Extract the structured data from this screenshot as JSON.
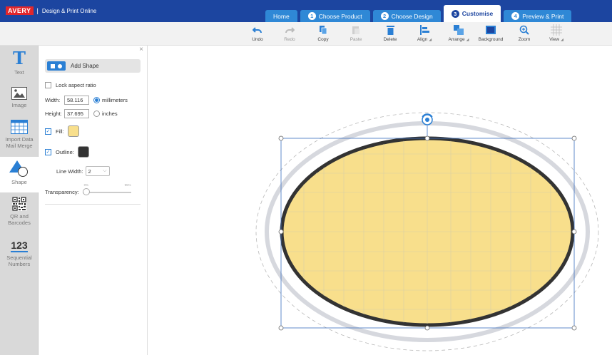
{
  "brand": {
    "logo": "AVERY",
    "separator": "|",
    "subtitle": "Design & Print Online"
  },
  "tabs": [
    {
      "num": "",
      "label": "Home",
      "active": false
    },
    {
      "num": "1",
      "label": "Choose Product",
      "active": false
    },
    {
      "num": "2",
      "label": "Choose Design",
      "active": false
    },
    {
      "num": "3",
      "label": "Customise",
      "active": true
    },
    {
      "num": "4",
      "label": "Preview & Print",
      "active": false
    }
  ],
  "toolbar": {
    "undo": "Undo",
    "redo": "Redo",
    "copy": "Copy",
    "paste": "Paste",
    "delete": "Delete",
    "align": "Align",
    "arrange": "Arrange",
    "background": "Background",
    "zoom": "Zoom",
    "view": "View"
  },
  "rail": {
    "text": "Text",
    "image": "Image",
    "import": "Import Data Mail Merge",
    "shape": "Shape",
    "qr": "QR and Barcodes",
    "numbers_icon": "123",
    "numbers": "Sequential Numbers"
  },
  "panel": {
    "close": "×",
    "add_shape": "Add Shape",
    "lock_aspect": "Lock aspect ratio",
    "width_label": "Width:",
    "width_value": "58.116",
    "height_label": "Height:",
    "height_value": "37.695",
    "unit_mm": "millimeters",
    "unit_in": "inches",
    "fill_label": "Fill:",
    "outline_label": "Outline:",
    "line_width_label": "Line Width:",
    "line_width_value": "2",
    "transparency_label": "Transparency:",
    "transparency_min": "0%",
    "transparency_max": "95%",
    "transparency_value": 0
  },
  "colors": {
    "fill": "#f8df8c",
    "outline": "#333333",
    "accent": "#2a7fd4",
    "topbar": "#1c45a0"
  }
}
